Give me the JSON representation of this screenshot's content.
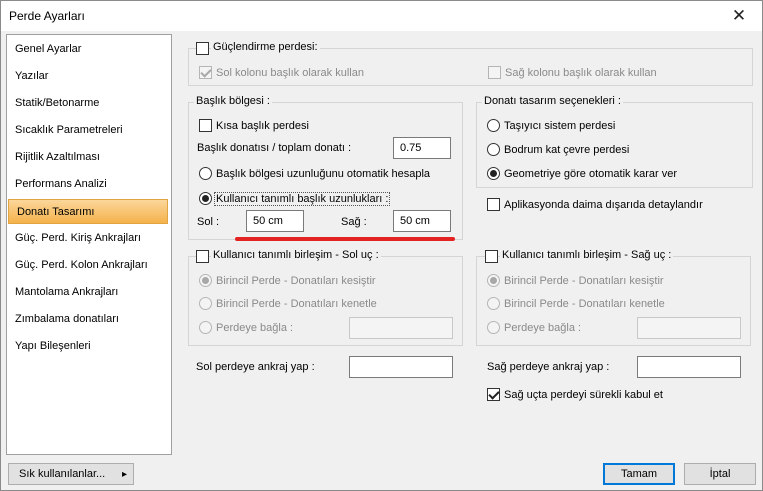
{
  "window": {
    "title": "Perde Ayarları",
    "close_glyph": "✕"
  },
  "sidebar": {
    "items": [
      {
        "label": "Genel Ayarlar"
      },
      {
        "label": "Yazılar"
      },
      {
        "label": "Statik/Betonarme"
      },
      {
        "label": "Sıcaklık Parametreleri"
      },
      {
        "label": "Rijitlik Azaltılması"
      },
      {
        "label": "Performans Analizi"
      },
      {
        "label": "Donatı Tasarımı"
      },
      {
        "label": "Güç. Perd. Kiriş Ankrajları"
      },
      {
        "label": "Güç. Perd. Kolon Ankrajları"
      },
      {
        "label": "Mantolama Ankrajları"
      },
      {
        "label": "Zımbalama donatıları"
      },
      {
        "label": "Yapı Bileşenleri"
      }
    ],
    "active": "Donatı Tasarımı"
  },
  "guclendirme": {
    "title": "Güçlendirme perdesi:",
    "sol_kolonu": "Sol kolonu başlık olarak kullan",
    "sag_kolonu": "Sağ kolonu başlık olarak kullan"
  },
  "baslik_bolgesi": {
    "title": "Başlık bölgesi :",
    "kisa_baslik": "Kısa başlık perdesi",
    "ratio_label": "Başlık donatısı / toplam donatı :",
    "ratio_value": "0.75",
    "auto_length": "Başlık bölgesi uzunluğunu otomatik hesapla",
    "user_length": "Kullanıcı tanımlı başlık uzunlukları :",
    "sol_label": "Sol :",
    "sol_value": "50 cm",
    "sag_label": "Sağ :",
    "sag_value": "50 cm"
  },
  "donati_tasarim": {
    "title": "Donatı tasarım seçenekleri :",
    "option1": "Taşıyıcı sistem perdesi",
    "option2": "Bodrum kat çevre perdesi",
    "option3": "Geometriye göre otomatik karar ver",
    "aplikasyon": "Aplikasyonda daima dışarıda detaylandır"
  },
  "sol_uc": {
    "title": "Kullanıcı tanımlı birleşim - Sol uç :",
    "opt1": "Birincil Perde - Donatıları kesiştir",
    "opt2": "Birincil Perde - Donatıları kenetle",
    "opt3": "Perdeye bağla :"
  },
  "sag_uc": {
    "title": "Kullanıcı tanımlı birleşim - Sağ uç :",
    "opt1": "Birincil Perde - Donatıları kesiştir",
    "opt2": "Birincil Perde - Donatıları kenetle",
    "opt3": "Perdeye bağla :"
  },
  "ankraj": {
    "sol_label": "Sol perdeye ankraj yap :",
    "sag_label": "Sağ perdeye ankraj yap :",
    "surekli": "Sağ uçta perdeyi sürekli kabul et"
  },
  "footer": {
    "frequent": "Sık kullanılanlar...",
    "frequent_arrow": "▸",
    "ok": "Tamam",
    "cancel": "İptal"
  },
  "colors": {
    "highlight": "#f5b24b",
    "annotation_red": "#e32222",
    "default_button_border": "#0078d7"
  }
}
